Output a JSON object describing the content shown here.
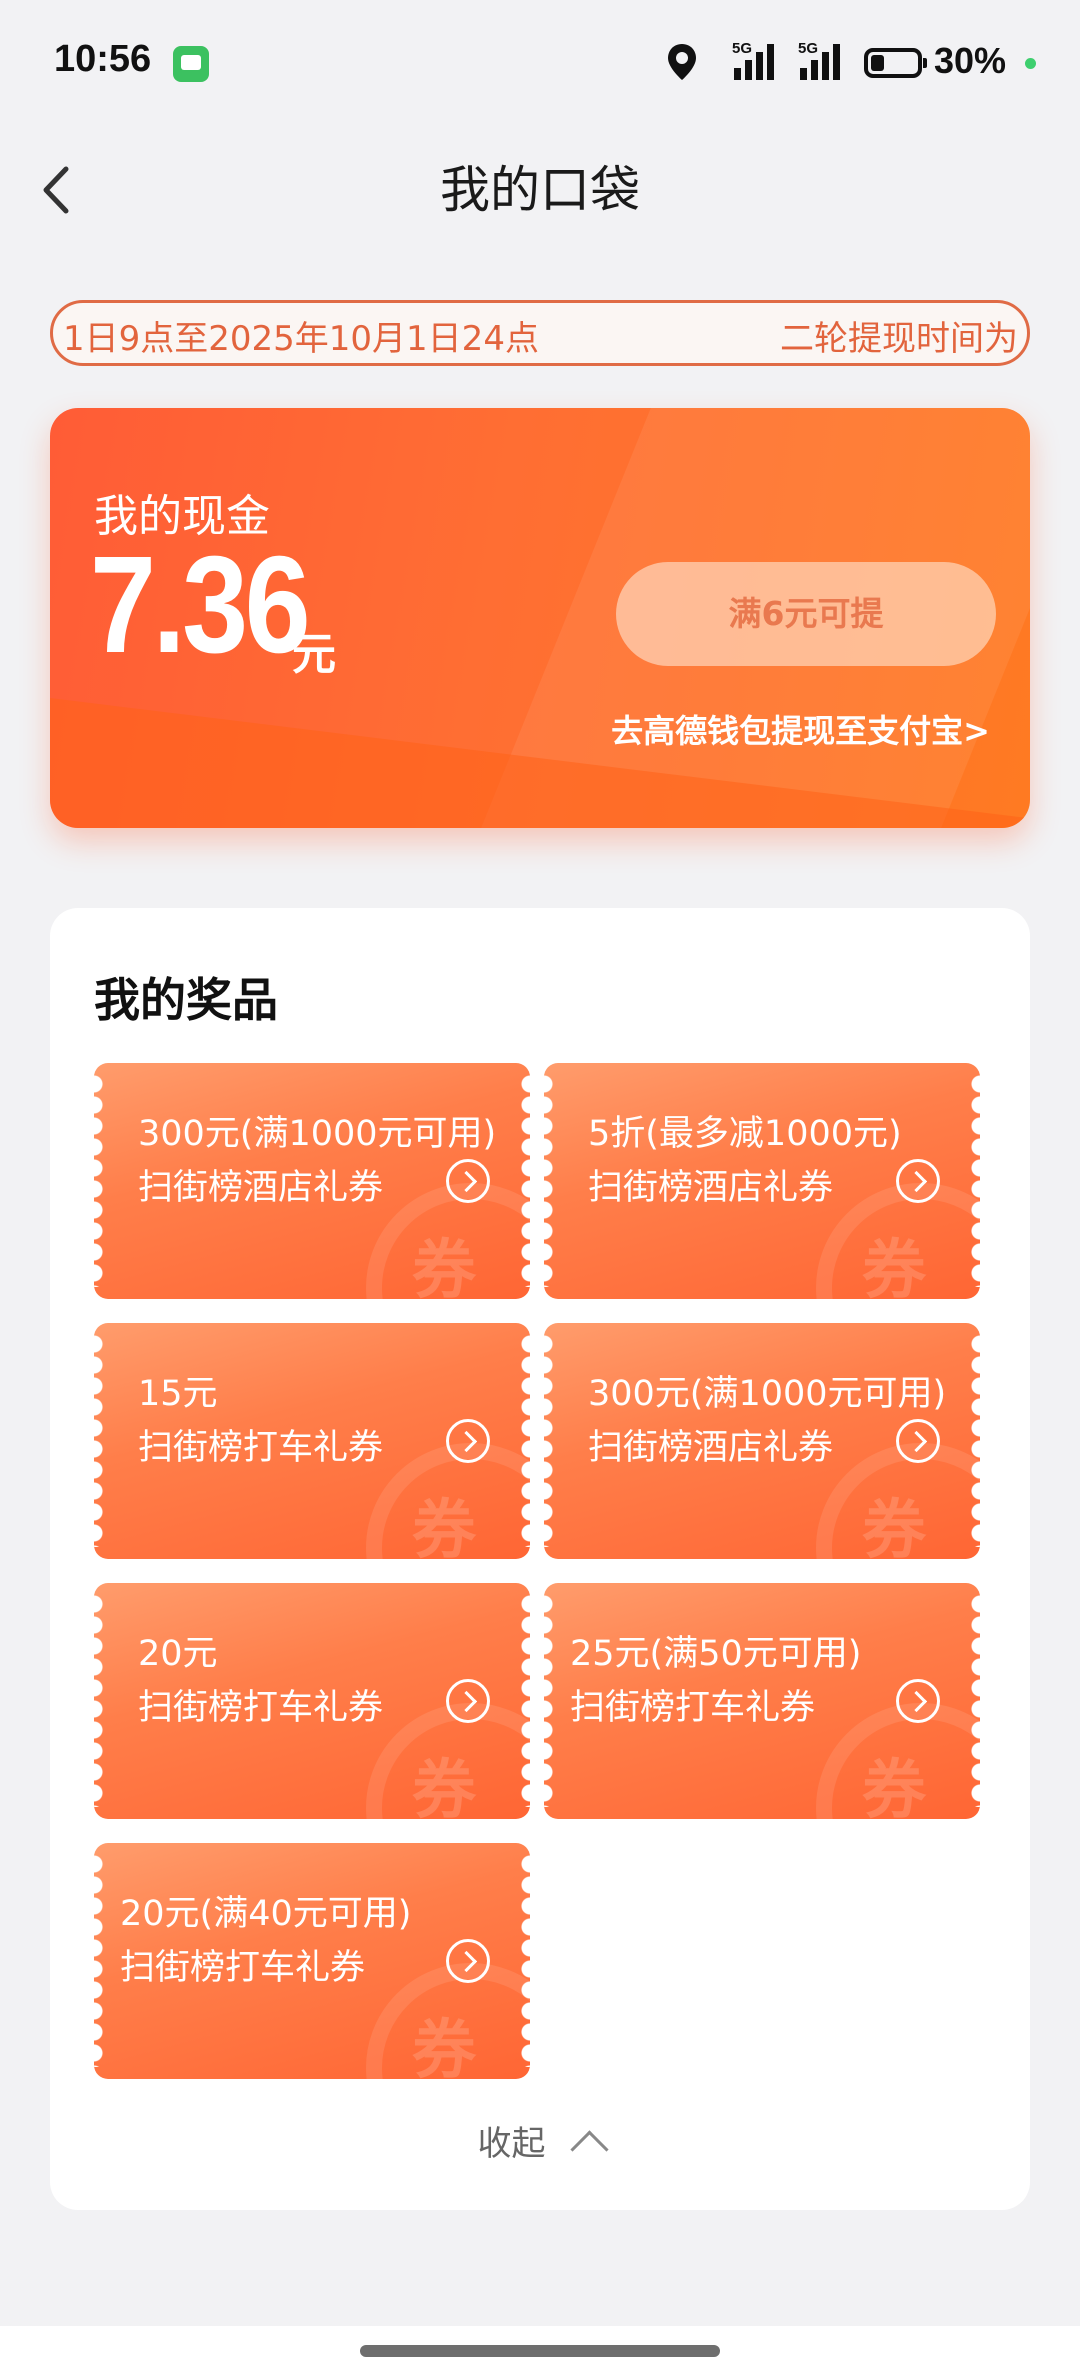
{
  "status_bar": {
    "time": "10:56",
    "network_1": "5G",
    "network_2": "5G",
    "battery": "30%",
    "icons": [
      "message-icon",
      "location-icon",
      "signal-icon",
      "signal-icon",
      "battery-icon"
    ]
  },
  "nav": {
    "title": "我的口袋",
    "back_icon": "chevron-left-icon"
  },
  "marquee": {
    "text": "1日9点至2025年10月1日24点",
    "text_2": "二轮提现时间为"
  },
  "cash": {
    "label": "我的现金",
    "amount": "7.36",
    "unit": "元",
    "withdraw_button": "满6元可提",
    "alipay_link": "去高德钱包提现至支付宝>"
  },
  "prizes": {
    "title": "我的奖品",
    "stamp_char": "券",
    "items": [
      {
        "value": "300元(满1000元可用)",
        "desc": "扫街榜酒店礼券"
      },
      {
        "value": "5折(最多减1000元)",
        "desc": "扫街榜酒店礼券"
      },
      {
        "value": "15元",
        "desc": "扫街榜打车礼券"
      },
      {
        "value": "300元(满1000元可用)",
        "desc": "扫街榜酒店礼券"
      },
      {
        "value": "20元",
        "desc": "扫街榜打车礼券"
      },
      {
        "value": "25元(满50元可用)",
        "desc": "扫街榜打车礼券"
      },
      {
        "value": "20元(满40元可用)",
        "desc": "扫街榜打车礼券"
      }
    ],
    "collapse_label": "收起"
  },
  "colors": {
    "accent": "#ff6a34",
    "marquee_border": "#e06b45",
    "status_dot": "#3ecf6e"
  }
}
